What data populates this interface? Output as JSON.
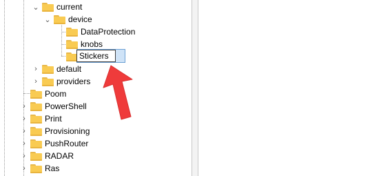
{
  "tree": {
    "items": [
      {
        "label": "current",
        "state": "expanded"
      },
      {
        "label": "device",
        "state": "expanded"
      },
      {
        "label": "DataProtection",
        "state": "leaf"
      },
      {
        "label": "knobs",
        "state": "leaf"
      },
      {
        "label": "Stickers",
        "state": "renaming"
      },
      {
        "label": "default",
        "state": "collapsed"
      },
      {
        "label": "providers",
        "state": "collapsed"
      },
      {
        "label": "Poom",
        "state": "leaf"
      },
      {
        "label": "PowerShell",
        "state": "collapsed"
      },
      {
        "label": "Print",
        "state": "collapsed"
      },
      {
        "label": "Provisioning",
        "state": "collapsed"
      },
      {
        "label": "PushRouter",
        "state": "collapsed"
      },
      {
        "label": "RADAR",
        "state": "collapsed"
      },
      {
        "label": "Ras",
        "state": "collapsed"
      }
    ]
  },
  "rename_value": "Stickers",
  "colors": {
    "folder": "#f9cb52",
    "selection": "#cfe3f7",
    "arrow": "#ef3b3b"
  },
  "icons": {
    "expanded": "chevron-down-icon",
    "collapsed": "chevron-right-icon",
    "folder": "folder-icon",
    "annotation": "red-arrow-icon"
  }
}
